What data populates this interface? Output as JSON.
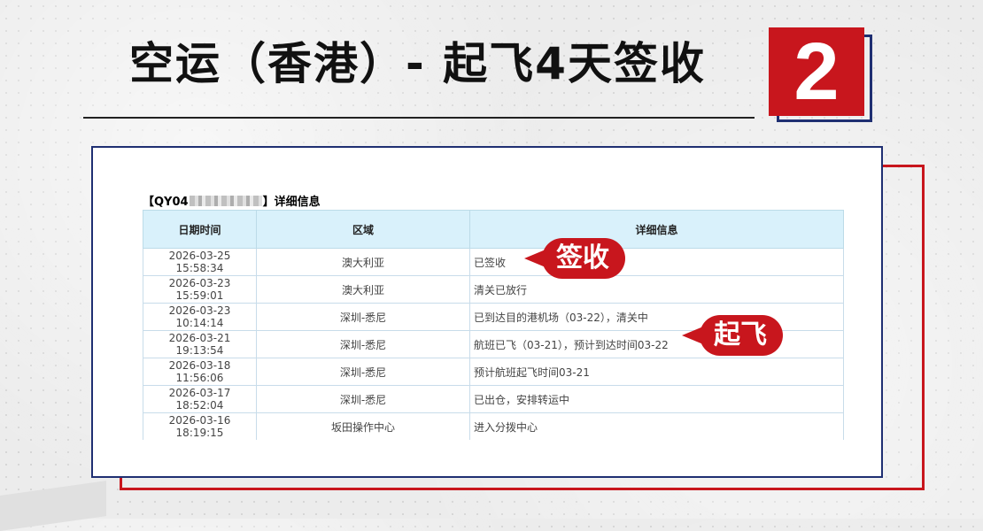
{
  "header": {
    "title": "空运（香港）- 起飞4天签收",
    "badge_number": "2"
  },
  "record": {
    "title_prefix": "【QY04",
    "title_suffix": "】详细信息"
  },
  "table": {
    "columns": [
      "日期时间",
      "区域",
      "详细信息"
    ],
    "rows": [
      {
        "datetime": "2026-03-25 15:58:34",
        "region": "澳大利亚",
        "detail": "已签收"
      },
      {
        "datetime": "2026-03-23 15:59:01",
        "region": "澳大利亚",
        "detail": "清关已放行"
      },
      {
        "datetime": "2026-03-23 10:14:14",
        "region": "深圳-悉尼",
        "detail": "已到达目的港机场（03-22），清关中"
      },
      {
        "datetime": "2026-03-21 19:13:54",
        "region": "深圳-悉尼",
        "detail": "航班已飞（03-21），预计到达时间03-22"
      },
      {
        "datetime": "2026-03-18 11:56:06",
        "region": "深圳-悉尼",
        "detail": "预计航班起飞时间03-21"
      },
      {
        "datetime": "2026-03-17 18:52:04",
        "region": "深圳-悉尼",
        "detail": "已出仓，安排转运中"
      },
      {
        "datetime": "2026-03-16 18:19:15",
        "region": "坂田操作中心",
        "detail": "进入分拨中心"
      }
    ]
  },
  "callouts": {
    "signed": "签收",
    "takeoff": "起飞"
  },
  "colors": {
    "accent_red": "#c8161d",
    "navy": "#1f2f72",
    "header_cell": "#d9f1fb"
  }
}
